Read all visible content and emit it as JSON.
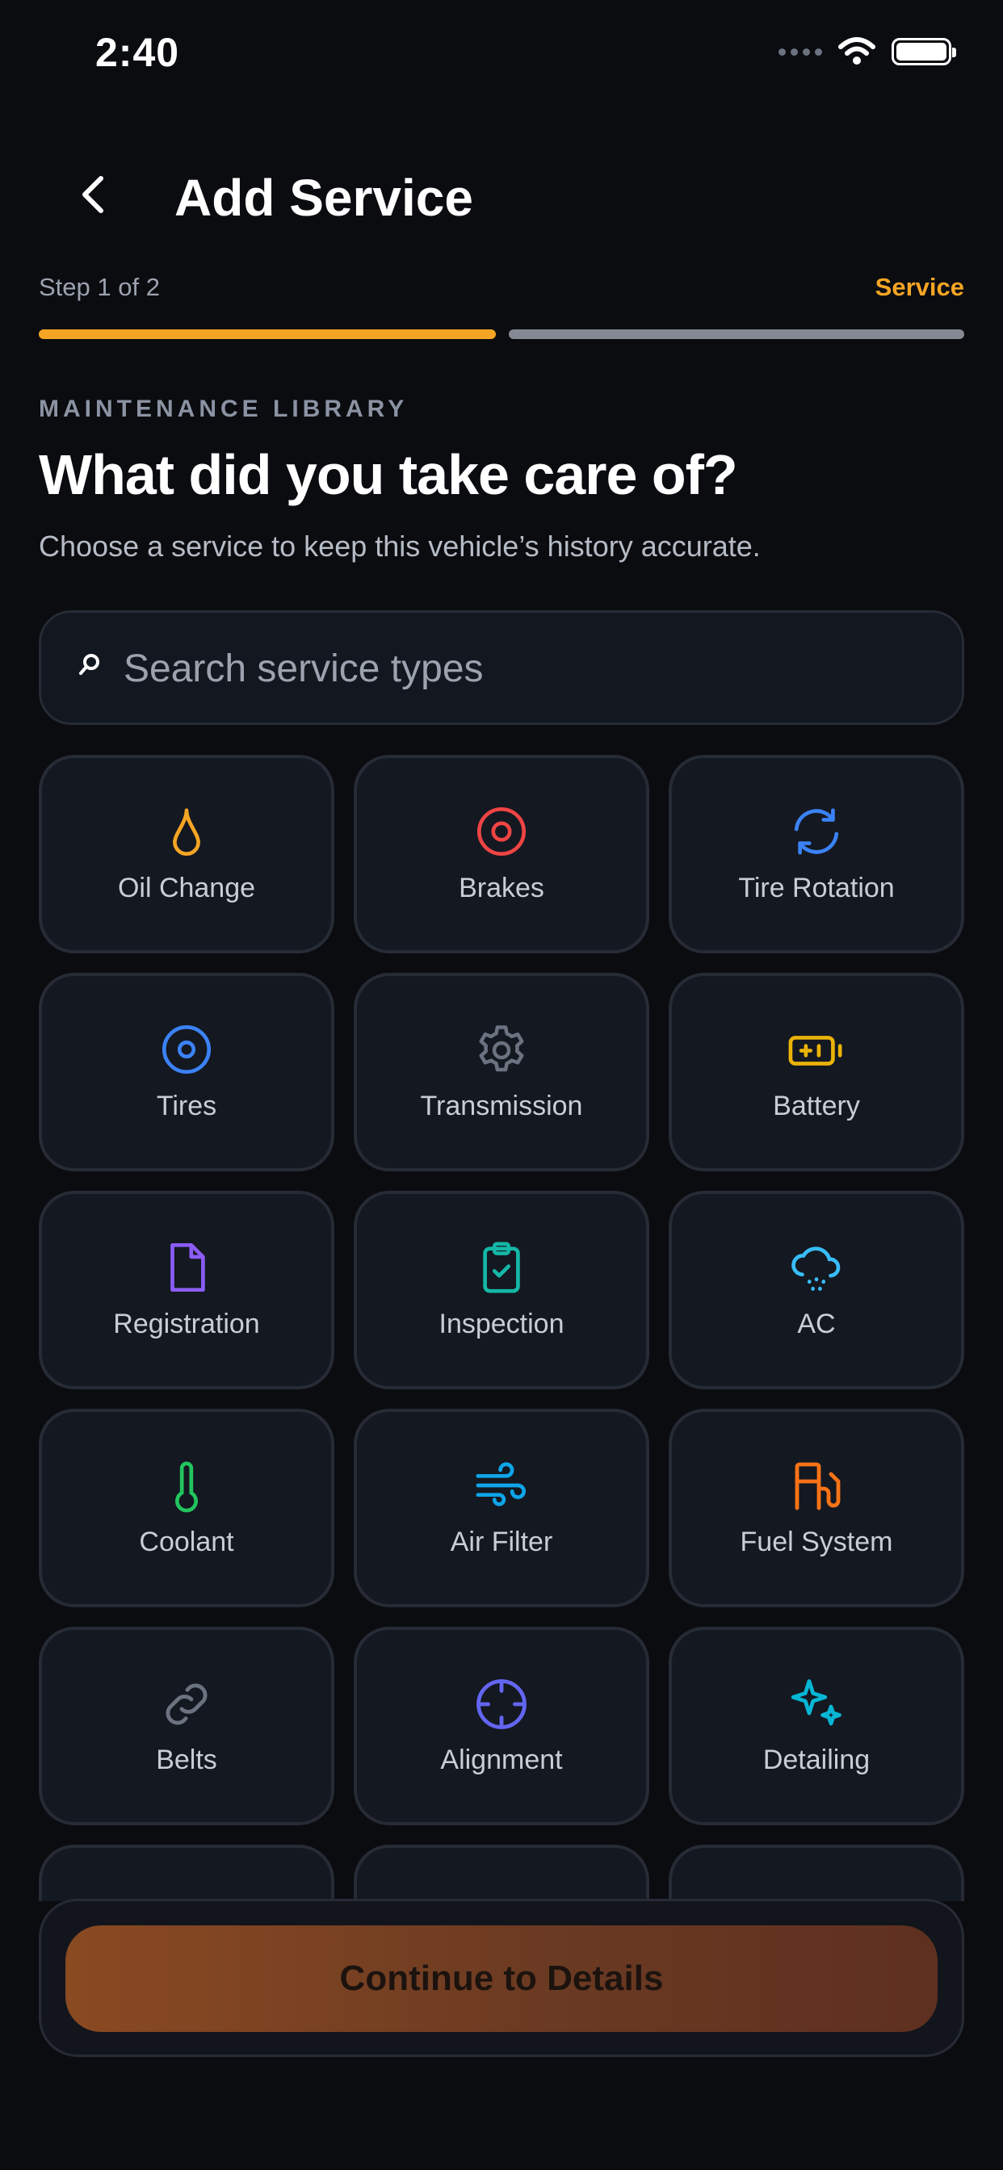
{
  "status_bar": {
    "time": "2:40"
  },
  "header": {
    "title": "Add Service"
  },
  "progress": {
    "step_label": "Step 1 of 2",
    "step_tag": "Service",
    "accent_color": "#f5a524",
    "value": 0.5
  },
  "intro": {
    "eyebrow": "MAINTENANCE LIBRARY",
    "question": "What did you take care of?",
    "helper": "Choose a service to keep this vehicle’s history accurate."
  },
  "search": {
    "placeholder": "Search service types"
  },
  "services": [
    {
      "label": "Oil Change",
      "icon": "oil-drop-icon",
      "color": "#f5a524"
    },
    {
      "label": "Brakes",
      "icon": "brake-disc-icon",
      "color": "#ef4444"
    },
    {
      "label": "Tire Rotation",
      "icon": "rotate-icon",
      "color": "#3b82f6"
    },
    {
      "label": "Tires",
      "icon": "tire-icon",
      "color": "#3b82f6"
    },
    {
      "label": "Transmission",
      "icon": "gear-icon",
      "color": "#6b7280"
    },
    {
      "label": "Battery",
      "icon": "battery-icon",
      "color": "#eab308"
    },
    {
      "label": "Registration",
      "icon": "document-icon",
      "color": "#8b5cf6"
    },
    {
      "label": "Inspection",
      "icon": "clipboard-check-icon",
      "color": "#14b8a6"
    },
    {
      "label": "AC",
      "icon": "cloud-snow-icon",
      "color": "#38bdf8"
    },
    {
      "label": "Coolant",
      "icon": "thermometer-icon",
      "color": "#22c55e"
    },
    {
      "label": "Air Filter",
      "icon": "wind-icon",
      "color": "#0ea5e9"
    },
    {
      "label": "Fuel System",
      "icon": "fuel-pump-icon",
      "color": "#f97316"
    },
    {
      "label": "Belts",
      "icon": "link-icon",
      "color": "#6b7280"
    },
    {
      "label": "Alignment",
      "icon": "crosshair-icon",
      "color": "#6366f1"
    },
    {
      "label": "Detailing",
      "icon": "sparkles-icon",
      "color": "#06b6d4"
    }
  ],
  "footer": {
    "cta_label": "Continue to Details"
  }
}
